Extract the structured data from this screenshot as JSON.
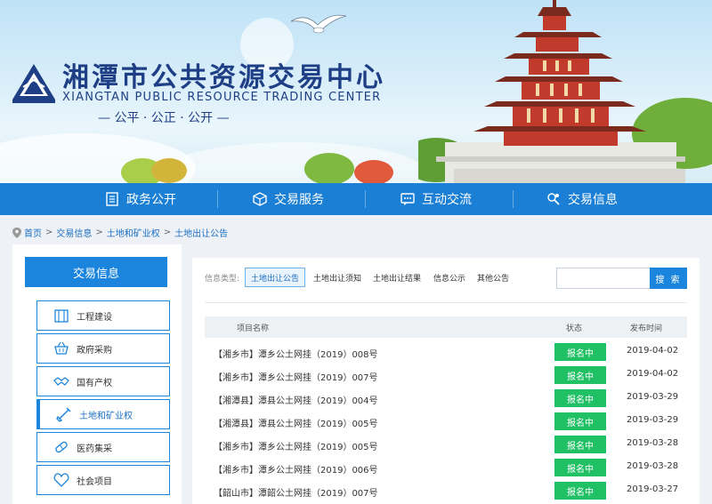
{
  "banner": {
    "title_cn": "湘潭市公共资源交易中心",
    "title_en": "XIANGTAN PUBLIC RESOURCE TRADING CENTER",
    "slogan": "— 公平 · 公正 · 公开 —"
  },
  "nav": {
    "items": [
      {
        "label": "政务公开",
        "icon": "document-list-icon"
      },
      {
        "label": "交易服务",
        "icon": "box-icon"
      },
      {
        "label": "互动交流",
        "icon": "chat-icon"
      },
      {
        "label": "交易信息",
        "icon": "search-people-icon"
      }
    ]
  },
  "breadcrumb": {
    "items": [
      "首页",
      "交易信息",
      "土地和矿业权",
      "土地出让公告"
    ],
    "separator": ">"
  },
  "sidebar": {
    "title": "交易信息",
    "items": [
      {
        "label": "工程建设",
        "icon": "building-icon"
      },
      {
        "label": "政府采购",
        "icon": "basket-icon"
      },
      {
        "label": "国有产权",
        "icon": "handshake-icon"
      },
      {
        "label": "土地和矿业权",
        "icon": "shovel-icon",
        "active": true
      },
      {
        "label": "医药集采",
        "icon": "pill-icon"
      },
      {
        "label": "社会项目",
        "icon": "heart-icon"
      }
    ]
  },
  "filter": {
    "label": "信息类型:",
    "tabs": [
      "土地出让公告",
      "土地出让须知",
      "土地出让结果",
      "信息公示",
      "其他公告"
    ],
    "active_index": 0
  },
  "search": {
    "placeholder": "",
    "button_label": "搜 索"
  },
  "table": {
    "columns": [
      "项目名称",
      "状态",
      "发布时间"
    ],
    "rows": [
      {
        "name": "【湘乡市】潭乡公土网挂（2019）008号",
        "status": "报名中",
        "date": "2019-04-02"
      },
      {
        "name": "【湘乡市】潭乡公土网挂（2019）007号",
        "status": "报名中",
        "date": "2019-04-02"
      },
      {
        "name": "【湘潭县】潭县公土网挂（2019）004号",
        "status": "报名中",
        "date": "2019-03-29"
      },
      {
        "name": "【湘潭县】潭县公土网挂（2019）005号",
        "status": "报名中",
        "date": "2019-03-29"
      },
      {
        "name": "【湘乡市】潭乡公土网挂（2019）005号",
        "status": "报名中",
        "date": "2019-03-28"
      },
      {
        "name": "【湘乡市】潭乡公土网挂（2019）006号",
        "status": "报名中",
        "date": "2019-03-28"
      },
      {
        "name": "【韶山市】潭韶公土网挂（2019）007号",
        "status": "报名中",
        "date": "2019-03-27"
      }
    ]
  },
  "colors": {
    "nav_blue": "#1b7fd6",
    "accent_blue": "#1b85dd",
    "status_green": "#20c064",
    "logo_navy": "#1e3f85"
  }
}
